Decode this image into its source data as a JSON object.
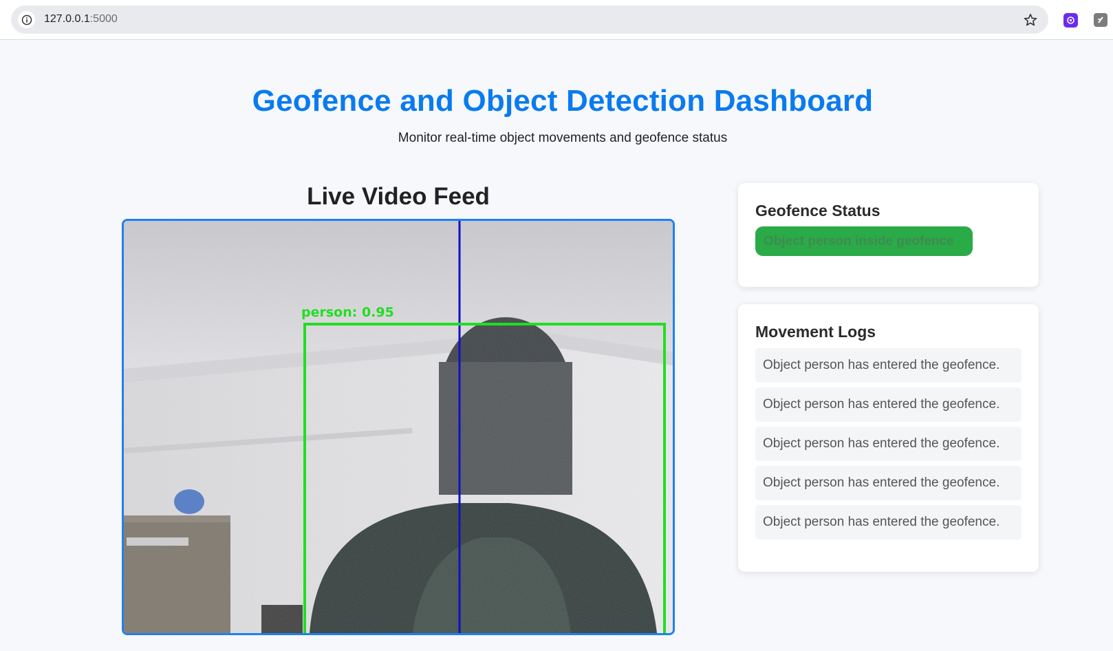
{
  "browser": {
    "url_host": "127.0.0.1",
    "url_port": ":5000"
  },
  "header": {
    "title": "Geofence and Object Detection Dashboard",
    "subtitle": "Monitor real-time object movements and geofence status"
  },
  "video": {
    "title": "Live Video Feed",
    "detection_label": "person: 0.95",
    "colors": {
      "frame_border": "#1f80ee",
      "detection_box": "#22dd22",
      "geofence_line": "#1010c8"
    }
  },
  "geofence_status": {
    "title": "Geofence Status",
    "badge": "Object person inside geofence",
    "badge_color": "#2aab48"
  },
  "movement_logs": {
    "title": "Movement Logs",
    "items": [
      "Object person has entered the geofence.",
      "Object person has entered the geofence.",
      "Object person has entered the geofence.",
      "Object person has entered the geofence.",
      "Object person has entered the geofence."
    ]
  },
  "icons": [
    "info-icon",
    "star-icon",
    "extension-icon",
    "extension-icon"
  ],
  "colors": {
    "accent": "#0a7bef",
    "page_bg": "#f6f8fb"
  }
}
